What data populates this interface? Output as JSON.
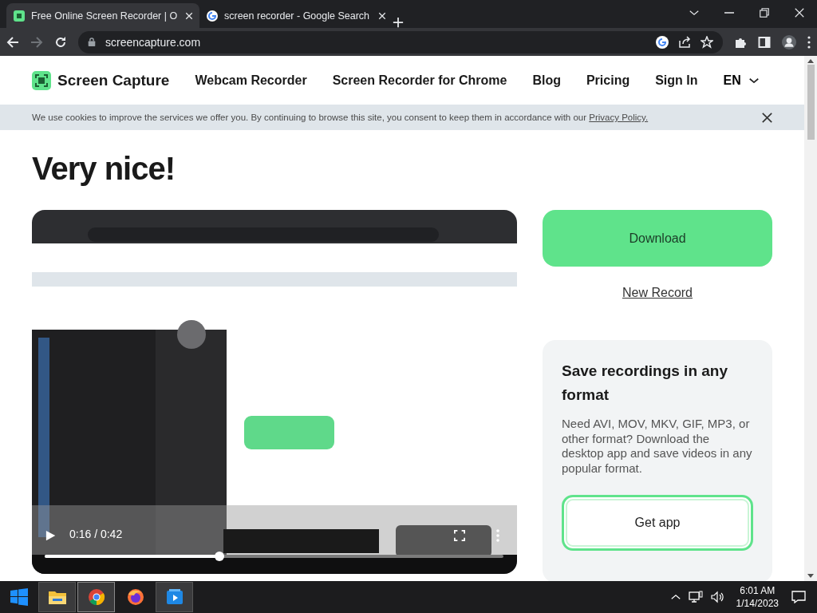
{
  "browser": {
    "tabs": [
      {
        "title": "Free Online Screen Recorder | O",
        "kind": "site",
        "selected": true
      },
      {
        "title": "screen recorder - Google Search",
        "kind": "google",
        "selected": false
      }
    ],
    "url": "screencapture.com",
    "forward_disabled": true
  },
  "page": {
    "nav": {
      "brand": "Screen Capture",
      "links": [
        "Webcam Recorder",
        "Screen Recorder for Chrome",
        "Blog",
        "Pricing",
        "Sign In"
      ],
      "language": "EN"
    },
    "cookie_banner": {
      "text": "We use cookies to improve the services we offer you. By continuing to browse this site, you consent to keep them in accordance with our",
      "link": "Privacy Policy."
    },
    "heading": "Very nice!",
    "video": {
      "time": "0:16 / 0:42",
      "level": 0.38
    },
    "download_button": "Download",
    "new_record_link": "New Record",
    "card": {
      "title": "Save recordings in any format",
      "text": "Need AVI, MOV, MKV, GIF, MP3, or other format? Download the desktop app and save videos in any popular format.",
      "button": "Get app"
    }
  },
  "taskbar": {
    "apps": [
      {
        "kind": "explorer",
        "open": true,
        "selected": false
      },
      {
        "kind": "chrome",
        "open": true,
        "selected": true
      },
      {
        "kind": "firefox",
        "open": false,
        "selected": false
      },
      {
        "kind": "media",
        "open": true,
        "selected": false
      }
    ],
    "time": "6:01 AM",
    "date": "1/14/2023"
  }
}
